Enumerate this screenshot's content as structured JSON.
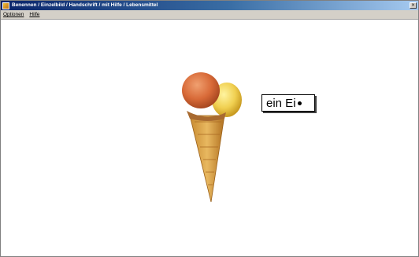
{
  "window": {
    "title": "Benennen / Einzelbild / Handschrift / mit Hilfe / Lebensmittel",
    "close_symbol": "×"
  },
  "menu": {
    "items": [
      "Optionen",
      "Hilfe"
    ]
  },
  "main": {
    "image_icon": "ice-cream-cone-icon",
    "word_card": {
      "text": "ein Ei"
    }
  },
  "colors": {
    "titlebar_start": "#0a246a",
    "titlebar_end": "#a6caf0",
    "background": "#ffffff"
  }
}
